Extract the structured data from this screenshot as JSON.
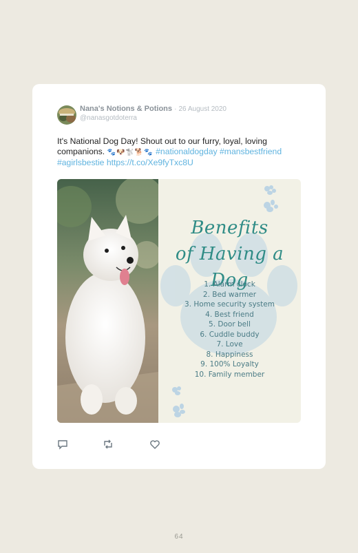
{
  "tweet": {
    "author_name": "Nana's Notions & Potions",
    "separator": "·",
    "date": "26 August 2020",
    "handle": "@nanasgotdoterra",
    "text_line": "It's National Dog Day! Shout out to our furry, loyal, loving companions.",
    "emoji": "🐾🐶🐩🐕🐾",
    "hashtag_1": "#nationaldogday",
    "hashtag_2": "#mansbestfriend",
    "hashtag_3": "#agirlsbestie",
    "link": "https://t.co/Xe9fyTxc8U"
  },
  "graphic": {
    "title_line1": "Benefits",
    "title_line2": "of Having a Dog",
    "items": [
      "1. Alarm clock",
      "2. Bed warmer",
      "3. Home security system",
      "4. Best friend",
      "5. Door bell",
      "6. Cuddle buddy",
      "7. Love",
      "8. Happiness",
      "9. 100% Loyalty",
      "10. Family member"
    ]
  },
  "actions": [
    "reply-icon",
    "retweet-icon",
    "like-icon"
  ],
  "colors": {
    "background": "#edeae1",
    "link": "#5fb3df",
    "title_teal": "#2f8c86",
    "paw": "#bcd4e4"
  },
  "footer": {
    "page_number": "64"
  }
}
